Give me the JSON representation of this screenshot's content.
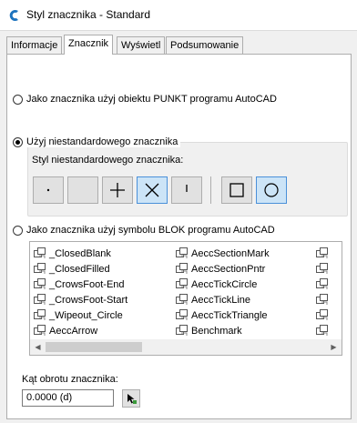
{
  "window": {
    "title": "Styl znacznika - Standard"
  },
  "tabs": [
    {
      "label": "Informacje"
    },
    {
      "label": "Znacznik",
      "active": true
    },
    {
      "label": "Wyświetl"
    },
    {
      "label": "Podsumowanie"
    }
  ],
  "options": {
    "point_object": {
      "label": "Jako znacznika użyj obiektu PUNKT programu AutoCAD",
      "checked": false
    },
    "custom_marker": {
      "label": "Użyj niestandardowego znacznika",
      "checked": true
    },
    "block_symbol": {
      "label": "Jako znacznika użyj symbolu BLOK programu AutoCAD",
      "checked": false
    }
  },
  "custom_marker_style": {
    "label": "Styl niestandardowego znacznika:",
    "buttons": [
      {
        "icon": "dot-icon",
        "selected": false
      },
      {
        "icon": "blank-icon",
        "selected": false
      },
      {
        "icon": "plus-icon",
        "selected": false
      },
      {
        "icon": "x-icon",
        "selected": true
      },
      {
        "icon": "tick-icon",
        "selected": false
      },
      {
        "icon": "square-icon",
        "selected": false
      },
      {
        "icon": "circle-icon",
        "selected": true
      }
    ]
  },
  "blocks": {
    "column1": [
      "_ClosedBlank",
      "_ClosedFilled",
      "_CrowsFoot-End",
      "_CrowsFoot-Start",
      "_Wipeout_Circle",
      "AeccArrow"
    ],
    "column2": [
      "AeccSectionMark",
      "AeccSectionPntr",
      "AeccTickCircle",
      "AeccTickLine",
      "AeccTickTriangle",
      "Benchmark"
    ],
    "item_icon": "block-icon"
  },
  "rotation": {
    "label": "Kąt obrotu znacznika:",
    "value": "0.0000 (d)"
  },
  "colors": {
    "selected_fill": "#cce4f7",
    "selected_border": "#4a90d9",
    "app_icon": "#1e73be"
  }
}
